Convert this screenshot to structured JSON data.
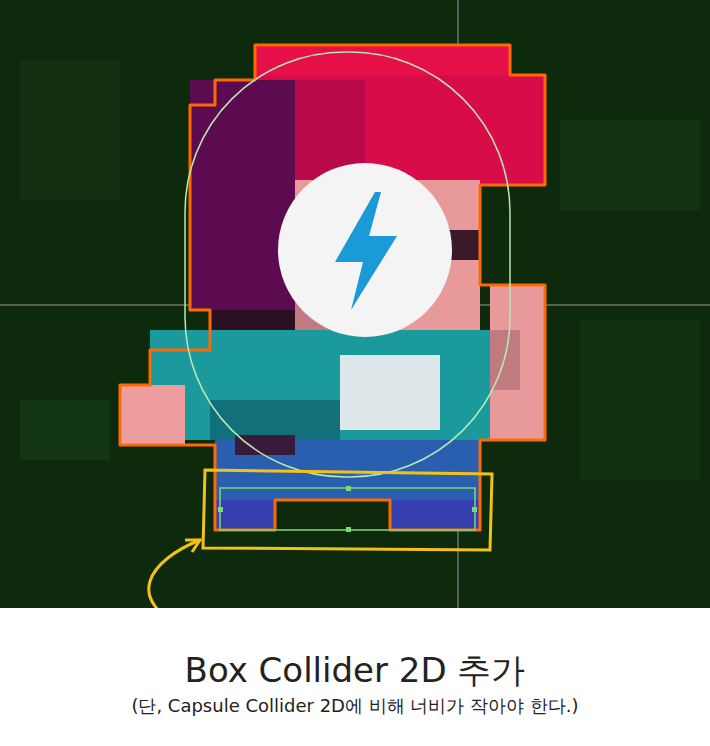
{
  "caption": {
    "title": "Box Collider 2D 추가",
    "note": "(단, Capsule Collider 2D에 비해 너비가 작아야 한다.)"
  }
}
